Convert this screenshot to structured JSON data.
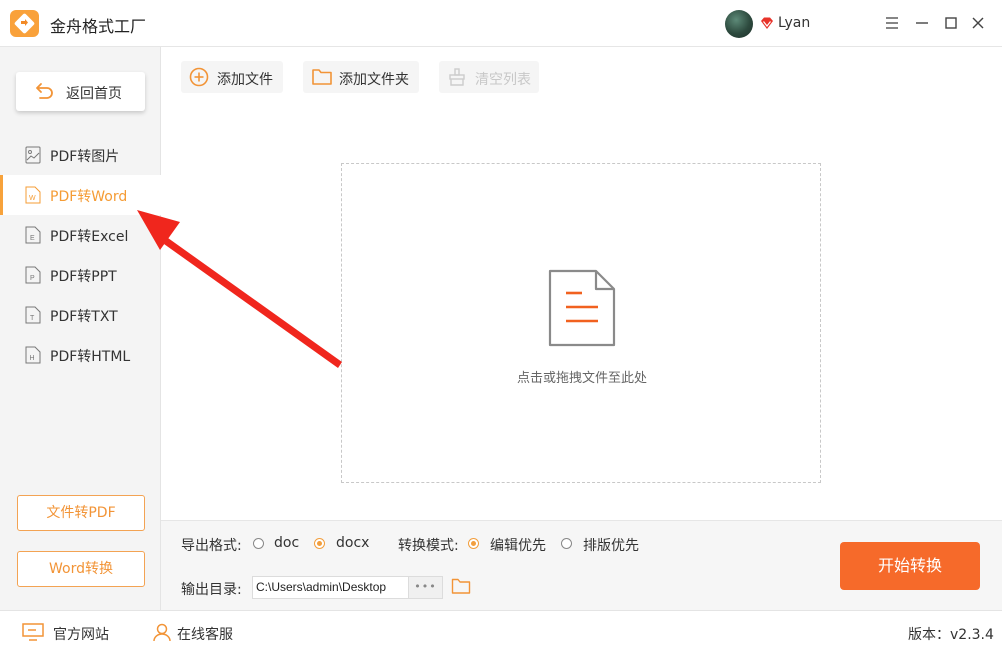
{
  "app": {
    "title": "金舟格式工厂",
    "username": "Lyan"
  },
  "sidebar": {
    "home_label": "返回首页",
    "items": [
      {
        "label": "PDF转图片",
        "icon": "image-file-icon"
      },
      {
        "label": "PDF转Word",
        "icon": "word-file-icon"
      },
      {
        "label": "PDF转Excel",
        "icon": "excel-file-icon"
      },
      {
        "label": "PDF转PPT",
        "icon": "ppt-file-icon"
      },
      {
        "label": "PDF转TXT",
        "icon": "txt-file-icon"
      },
      {
        "label": "PDF转HTML",
        "icon": "html-file-icon"
      }
    ],
    "active_index": 1,
    "file_to_pdf_label": "文件转PDF",
    "word_convert_label": "Word转换"
  },
  "toolbar": {
    "add_file": "添加文件",
    "add_folder": "添加文件夹",
    "clear_list": "清空列表"
  },
  "dropzone": {
    "hint": "点击或拖拽文件至此处"
  },
  "options": {
    "format_label": "导出格式:",
    "formats": [
      "doc",
      "docx"
    ],
    "selected_format": "docx",
    "mode_label": "转换模式:",
    "modes": [
      "编辑优先",
      "排版优先"
    ],
    "selected_mode": "编辑优先",
    "output_label": "输出目录:",
    "output_path": "C:\\Users\\admin\\Desktop",
    "more_label": "•••"
  },
  "start_button": "开始转换",
  "footer": {
    "website": "官方网站",
    "support": "在线客服",
    "version": "版本：v2.3.4"
  },
  "colors": {
    "accent": "#f59c35",
    "start": "#f66a2a",
    "arrow": "#f0261d"
  }
}
